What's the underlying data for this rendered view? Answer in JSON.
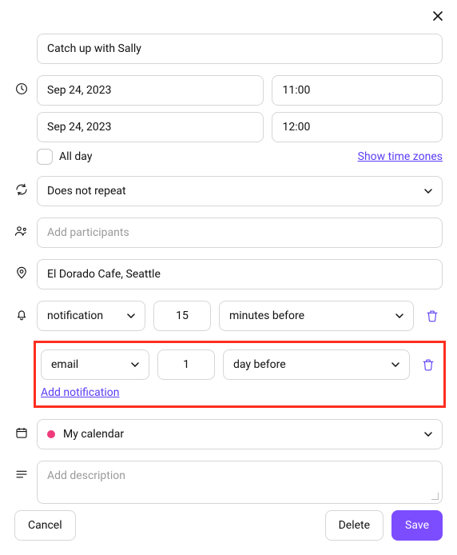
{
  "title_value": "Catch up with Sally",
  "date": {
    "start_date": "Sep 24, 2023",
    "start_time": "11:00",
    "end_date": "Sep 24, 2023",
    "end_time": "12:00",
    "all_day_label": "All day",
    "show_timezones_label": "Show time zones"
  },
  "repeat": {
    "value": "Does not repeat"
  },
  "participants": {
    "placeholder": "Add participants"
  },
  "location": {
    "value": "El Dorado Cafe, Seattle"
  },
  "notifications": [
    {
      "type": "notification",
      "amount": "15",
      "unit": "minutes before"
    },
    {
      "type": "email",
      "amount": "1",
      "unit": "day before"
    }
  ],
  "add_notification_label": "Add notification",
  "calendar": {
    "value": "My calendar",
    "color": "#ef3b7b"
  },
  "description": {
    "placeholder": "Add description"
  },
  "buttons": {
    "cancel": "Cancel",
    "delete": "Delete",
    "save": "Save"
  }
}
